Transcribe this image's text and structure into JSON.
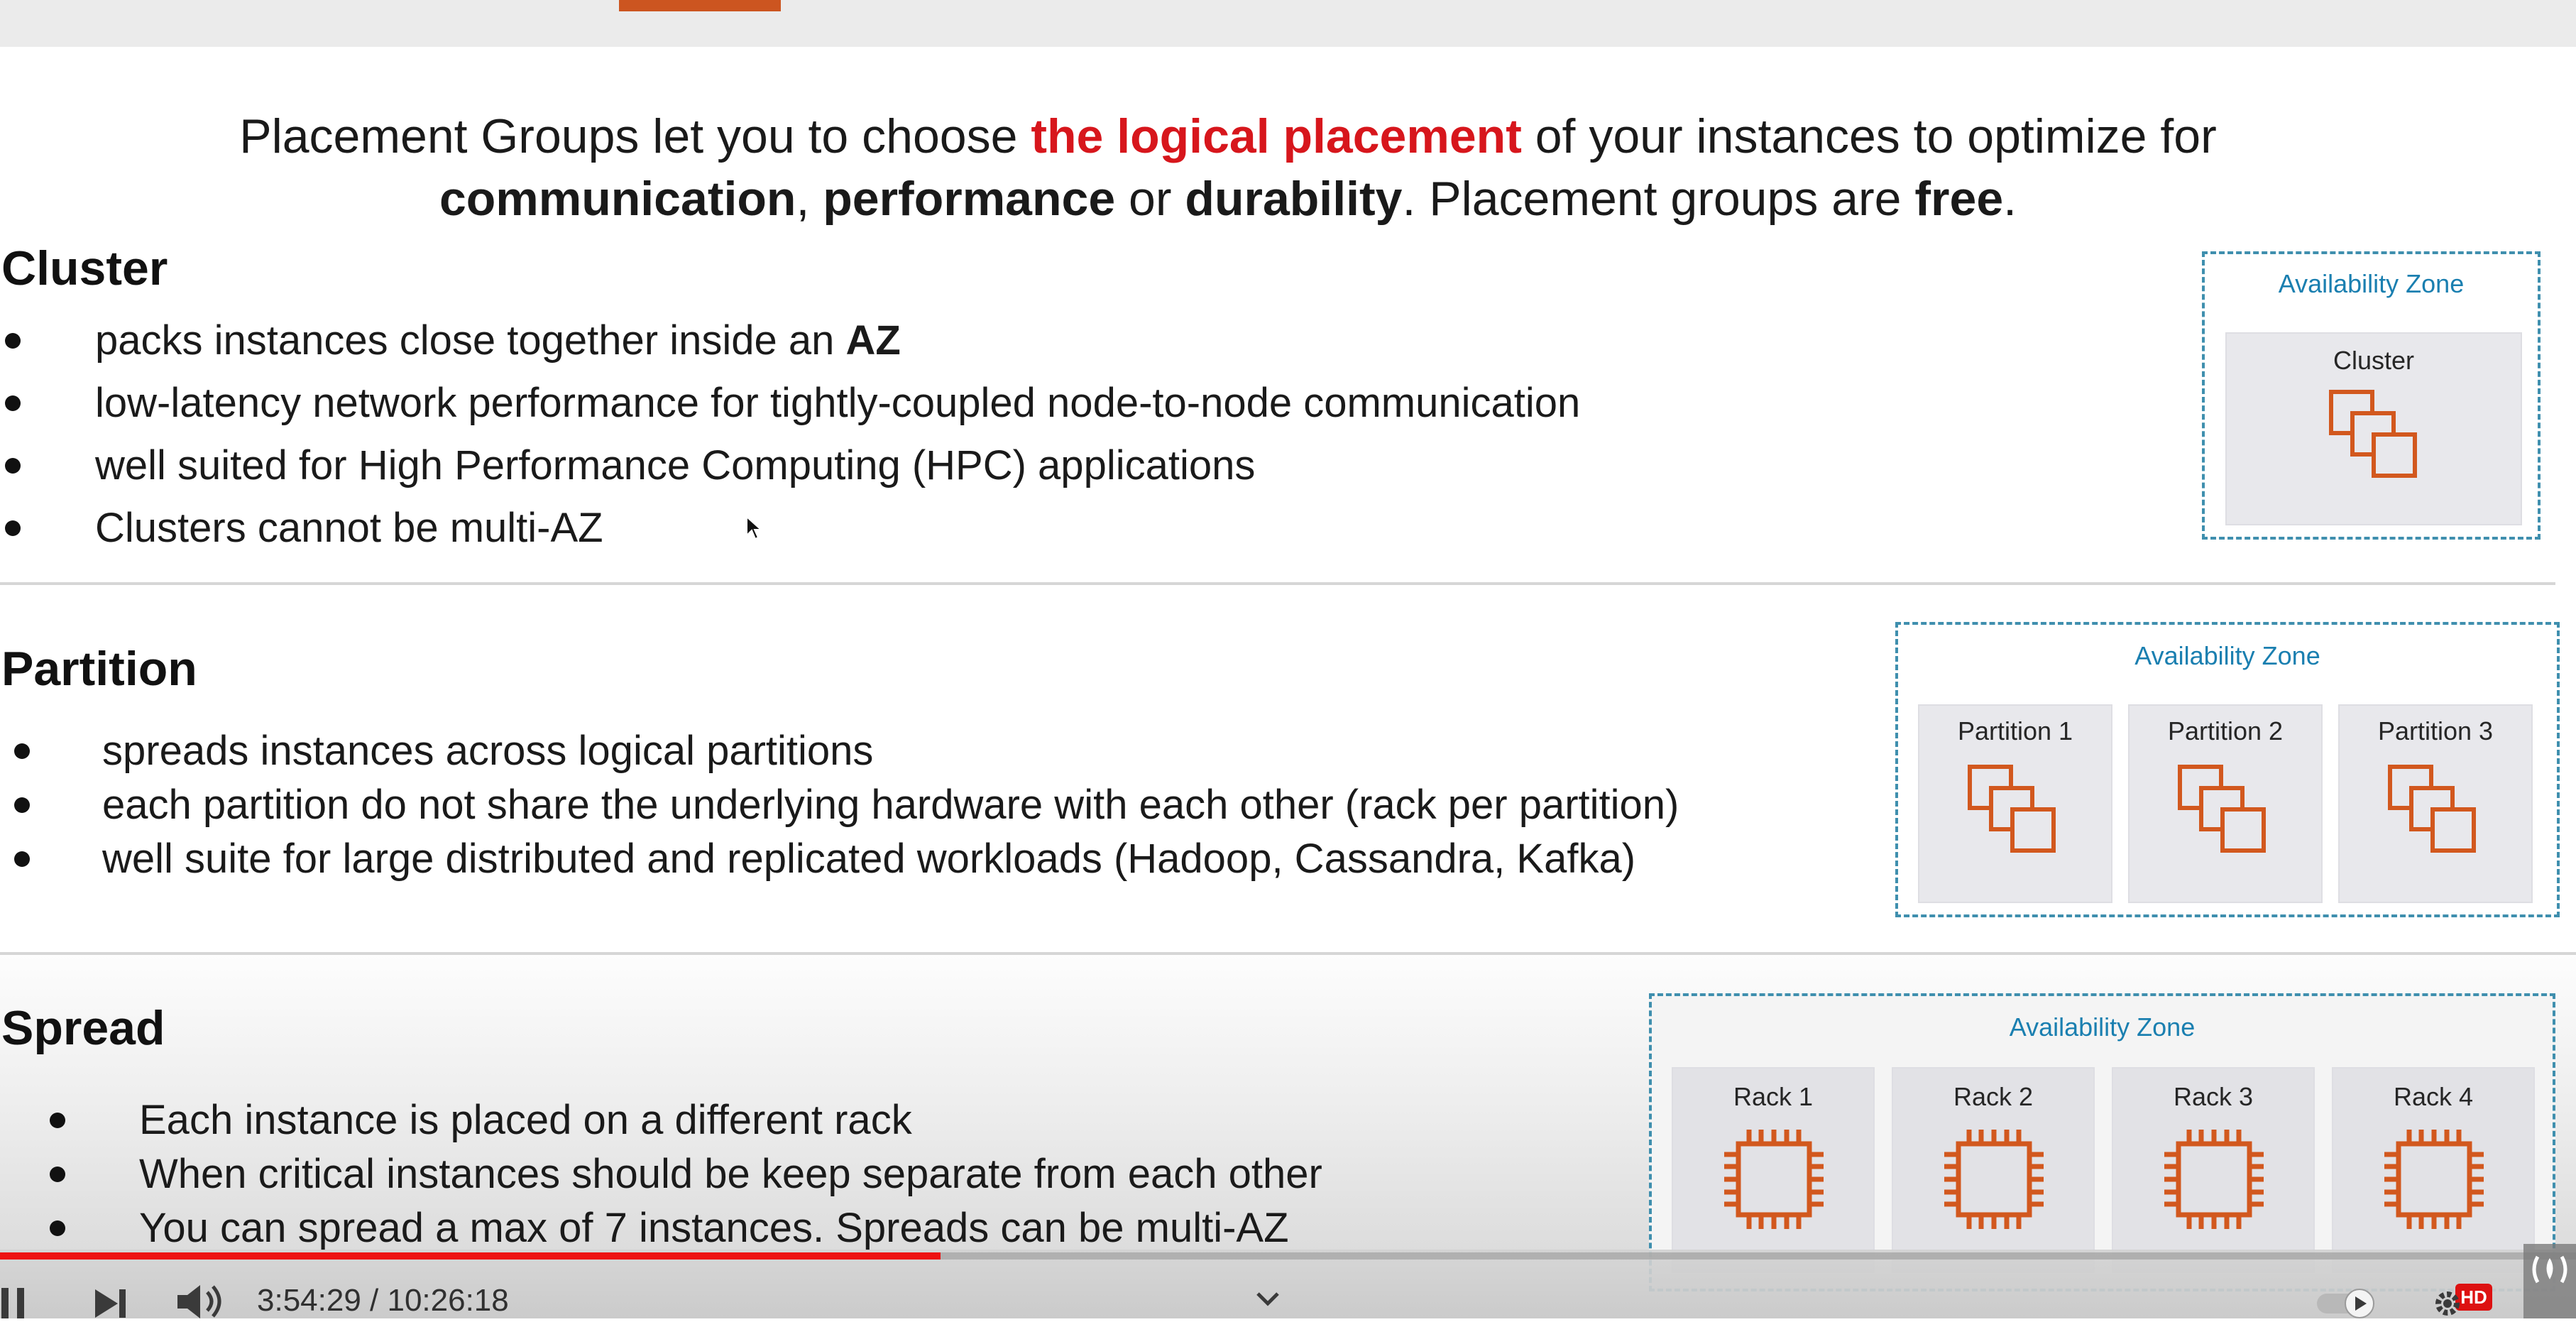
{
  "intro": {
    "line1_a": "Placement Groups let you to choose ",
    "line1_highlight": "the logical placement",
    "line1_b": " of your instances to optimize for",
    "line2_communication": "communication",
    "line2_sep1": ", ",
    "line2_performance": "performance",
    "line2_or": " or ",
    "line2_durability": "durability",
    "line2_mid": ". Placement groups are ",
    "line2_free": "free",
    "line2_end": "."
  },
  "cluster": {
    "title": "Cluster",
    "bullet1_a": "packs instances close together inside an ",
    "bullet1_bold": "AZ",
    "bullet2": "low-latency network performance for tightly-coupled node-to-node communication",
    "bullet3": "well suited for High Performance Computing (HPC) applications",
    "bullet4": "Clusters cannot be multi-AZ",
    "diagram": {
      "az_label": "Availability Zone",
      "box_label": "Cluster",
      "icon": "instances-stack-icon"
    }
  },
  "partition": {
    "title": "Partition",
    "bullets": [
      "spreads instances across logical partitions",
      "each partition do not share the underlying hardware with each other (rack per partition)",
      "well suite for large distributed and replicated workloads (Hadoop, Cassandra, Kafka)"
    ],
    "diagram": {
      "az_label": "Availability Zone",
      "boxes": [
        "Partition 1",
        "Partition 2",
        "Partition 3"
      ],
      "icon": "instances-stack-icon"
    }
  },
  "spread": {
    "title": "Spread",
    "bullets": [
      "Each instance is placed on a different rack",
      "When critical instances should be keep separate from each other",
      "You can spread a max of 7 instances. Spreads can be multi-AZ"
    ],
    "diagram": {
      "az_label": "Availability Zone",
      "boxes": [
        "Rack 1",
        "Rack 2",
        "Rack 3",
        "Rack 4"
      ],
      "icon": "chip-icon"
    }
  },
  "player": {
    "time": "3:54:29 / 10:26:18",
    "progress_fraction": 0.365,
    "hd_label": "HD",
    "colors": {
      "progress": "#ee1111",
      "accent_orange": "#cc5520",
      "az_border": "#3f8fae",
      "az_label": "#1a7fb0",
      "icon_orange": "#d2581e",
      "highlight_red": "#d7161c"
    }
  }
}
